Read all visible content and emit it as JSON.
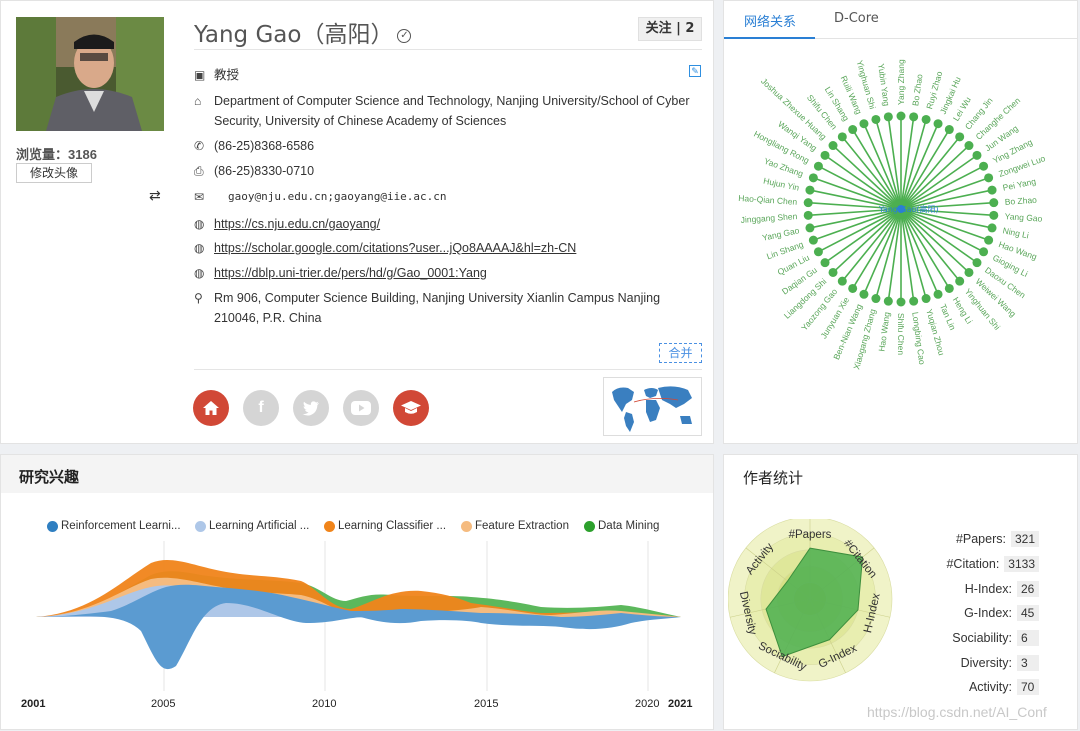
{
  "profile": {
    "name": "Yang Gao（高阳）",
    "views_label": "浏览量：",
    "views_value": "3186",
    "edit_avatar": "修改头像",
    "follow_label": "关注 | 2",
    "title": "教授",
    "affiliation": "Department of Computer Science and Technology, Nanjing University/School of Cyber Security, University of Chinese Academy of Sciences",
    "phone": "(86-25)8368-6586",
    "fax": "(86-25)8330-0710",
    "email": "gaoy@nju.edu.cn;gaoyang@iie.ac.cn",
    "homepage": "https://cs.nju.edu.cn/gaoyang/",
    "scholar": "https://scholar.google.com/citations?user...jQo8AAAAJ&hl=zh-CN",
    "dblp": "https://dblp.uni-trier.de/pers/hd/g/Gao_0001:Yang",
    "address": "Rm 906, Computer Science Building, Nanjing University Xianlin Campus  Nanjing 210046, P.R. China",
    "merge_label": "合并",
    "social": [
      "home-icon",
      "facebook-icon",
      "twitter-icon",
      "youtube-icon",
      "graduation-cap-icon"
    ]
  },
  "network": {
    "tabs": [
      "网络关系",
      "D-Core"
    ],
    "center_label": "Yang Gao(高阳)",
    "accent": "#4caf50",
    "nodes": [
      "Yang Zhang",
      "Bo Zhao",
      "Ruyi Zhao",
      "Jingkai Hu",
      "Lei Wu",
      "Chang Jin",
      "Changhe Chen",
      "Jun Wang",
      "Ying Zhang",
      "Zongwei Luo",
      "Pei Yang",
      "Bo Zhao",
      "Yang Gao",
      "Ning Li",
      "Hao Wang",
      "Gioging Li",
      "Daoxu Chen",
      "Weiwei Wang",
      "Yinghuan Shi",
      "Heng Li",
      "Tan Lin",
      "Yuqian Zhou",
      "Longbing Cao",
      "Shifu Chen",
      "Hao Wang",
      "Xiaogang Zhang",
      "Ben-Nian Wang",
      "Junyuan Xie",
      "Yaozong Gao",
      "Liangdong Shi",
      "Daqian Gu",
      "Quan Liu",
      "Lin Shang",
      "Yang Gao",
      "Jinggang Shen",
      "Hao-Qian Chen",
      "Hujun Yin",
      "Yao Zhang",
      "Hongliang Rong",
      "Wanqi Yang",
      "Joshua Zhexue Huang",
      "Shifu Chen",
      "Lin Shang",
      "Ruili Wang",
      "Yinghuan Shi",
      "Yubin Yang"
    ]
  },
  "interest": {
    "title": "研究兴趣",
    "legend": [
      {
        "label": "Reinforcement Learni...",
        "color": "#2f7fc1"
      },
      {
        "label": "Learning Artificial ...",
        "color": "#aec7e8"
      },
      {
        "label": "Learning Classifier ...",
        "color": "#f0841a"
      },
      {
        "label": "Feature Extraction",
        "color": "#f5bb7f"
      },
      {
        "label": "Data Mining",
        "color": "#2ca02c"
      }
    ],
    "years": [
      "2001",
      "2005",
      "2010",
      "2015",
      "2020",
      "2021"
    ]
  },
  "stats": {
    "title": "作者统计",
    "rows": [
      {
        "label": "#Papers:",
        "value": "321"
      },
      {
        "label": "#Citation:",
        "value": "3133"
      },
      {
        "label": "H-Index:",
        "value": "26"
      },
      {
        "label": "G-Index:",
        "value": "45"
      },
      {
        "label": "Sociability:",
        "value": "6"
      },
      {
        "label": "Diversity:",
        "value": "3"
      },
      {
        "label": "Activity:",
        "value": "70"
      }
    ],
    "radar_axes": [
      "#Papers",
      "#Citation",
      "H-Index",
      "G-Index",
      "Sociability",
      "Diversity",
      "Activity"
    ],
    "radar_values": [
      0.62,
      0.82,
      0.6,
      0.55,
      0.78,
      0.55,
      0.35
    ]
  },
  "watermark": "https://blog.csdn.net/AI_Conf"
}
